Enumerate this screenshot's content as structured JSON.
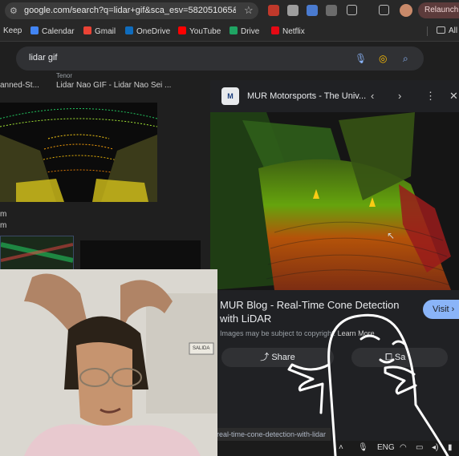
{
  "browser": {
    "url": "google.com/search?q=lidar+gif&sca_esv=582051065&hl...",
    "relaunch_label": "Relaunch to"
  },
  "bookmarks": [
    {
      "label": "Keep",
      "color": "#fbbc04"
    },
    {
      "label": "Calendar",
      "color": "#4285f4"
    },
    {
      "label": "Gmail",
      "color": "#ea4335"
    },
    {
      "label": "OneDrive",
      "color": "#0f6cbd"
    },
    {
      "label": "YouTube",
      "color": "#ff0000"
    },
    {
      "label": "Drive",
      "color": "#1fa463"
    },
    {
      "label": "Netflix",
      "color": "#e50914"
    }
  ],
  "bookmarks_folder": "All B",
  "search": {
    "query": "lidar gif"
  },
  "results": {
    "left_label_1": "anned-St...",
    "source_label": "Tenor",
    "title_2": "Lidar Nao GIF - Lidar Nao Sei ...",
    "sub_1": "m",
    "sub_2": "m"
  },
  "preview": {
    "favicon_text": "M",
    "site_title": "MUR Motorsports - The Univ...",
    "blog_title": "MUR Blog - Real-Time Cone Detection with LiDAR",
    "copyright_note": "Images may be subject to copyright.",
    "learn_more": "Learn More",
    "visit_label": "Visit",
    "share_label": "Share",
    "save_label": "Sa"
  },
  "status_url": "real-time-cone-detection-with-lidar",
  "taskbar": {
    "lang": "ENG"
  },
  "webcam": {
    "wall_sign": "SALIDA"
  }
}
